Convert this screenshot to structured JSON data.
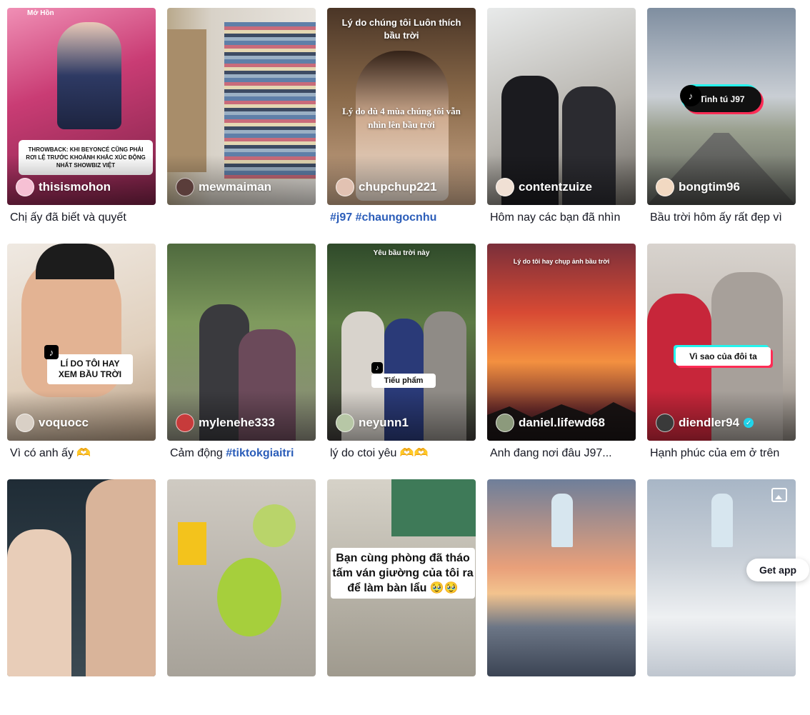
{
  "videos": [
    {
      "author": "thisismohon",
      "caption": "Chị ấy đã biết và quyết",
      "overlay": "THROWBACK: KHI BEYONCÉ CŨNG PHẢI RƠI LỆ TRƯỚC KHOẢNH KHẮC XÚC ĐỘNG NHẤT SHOWBIZ VIỆT",
      "top_label": "Mở Hồn",
      "bg": "#d6477a"
    },
    {
      "author": "mewmaiman",
      "caption": "",
      "bg": "#c8c0b4"
    },
    {
      "author": "chupchup221",
      "caption": "",
      "tags": [
        "#j97",
        "#chaungocnhu"
      ],
      "overlay_top": "Lý do chúng tôi Luôn thích bầu trời",
      "overlay_mid": "Lý do dù 4 mùa chúng tôi vẫn nhìn lên bầu trời",
      "bg": "#7a5a3c"
    },
    {
      "author": "contentzuize",
      "caption": "Hôm nay các bạn đã nhìn",
      "bg": "#9e9a95"
    },
    {
      "author": "bongtim96",
      "caption": "Bầu trời hôm ấy rất đẹp vì",
      "overlay": "Tinh tú J97",
      "bg": "#8e9aa8"
    },
    {
      "author": "voquocc",
      "caption": "Vì có anh ấy 🫶",
      "overlay": "LÍ DO TÔI HAY XEM BẦU TRỜI",
      "bg": "#d9c3a8"
    },
    {
      "author": "mylenehe333",
      "caption": "Cảm động",
      "tags": [
        "#tiktokgiaitri"
      ],
      "bg": "#5f7a4f"
    },
    {
      "author": "neyunn1",
      "caption": "lý do ctoi yêu 🫶🫶",
      "overlay_top": "Yêu bầu trời này",
      "overlay": "Tiểu phẩm",
      "bg": "#3f5a3a"
    },
    {
      "author": "daniel.lifewd68",
      "caption": "Anh đang nơi đâu J97...",
      "overlay_top": "Lý do tôi hay chụp ảnh bầu trời",
      "bg": "#e0642c"
    },
    {
      "author": "diendler94",
      "caption": "Hạnh phúc của em ở trên",
      "overlay": "Vì sao của đôi ta",
      "verified": true,
      "bg": "#b8b0a6"
    },
    {
      "author": "",
      "caption": "",
      "bg": "#2d3e4a"
    },
    {
      "author": "",
      "caption": "",
      "bg": "#a9a49c"
    },
    {
      "author": "",
      "caption": "",
      "overlay": "Bạn cùng phòng đã tháo tấm ván giường của tôi ra để làm bàn lẩu 🥹🥹",
      "bg": "#b7b2a6"
    },
    {
      "author": "",
      "caption": "",
      "bg": "#d98a5b"
    },
    {
      "author": "",
      "caption": "",
      "bg": "#9bb0c8"
    }
  ],
  "get_app_label": "Get app",
  "colors": {
    "hashtag": "#2b5db9",
    "accent_red": "#fe2c55",
    "accent_cyan": "#25f4ee"
  }
}
